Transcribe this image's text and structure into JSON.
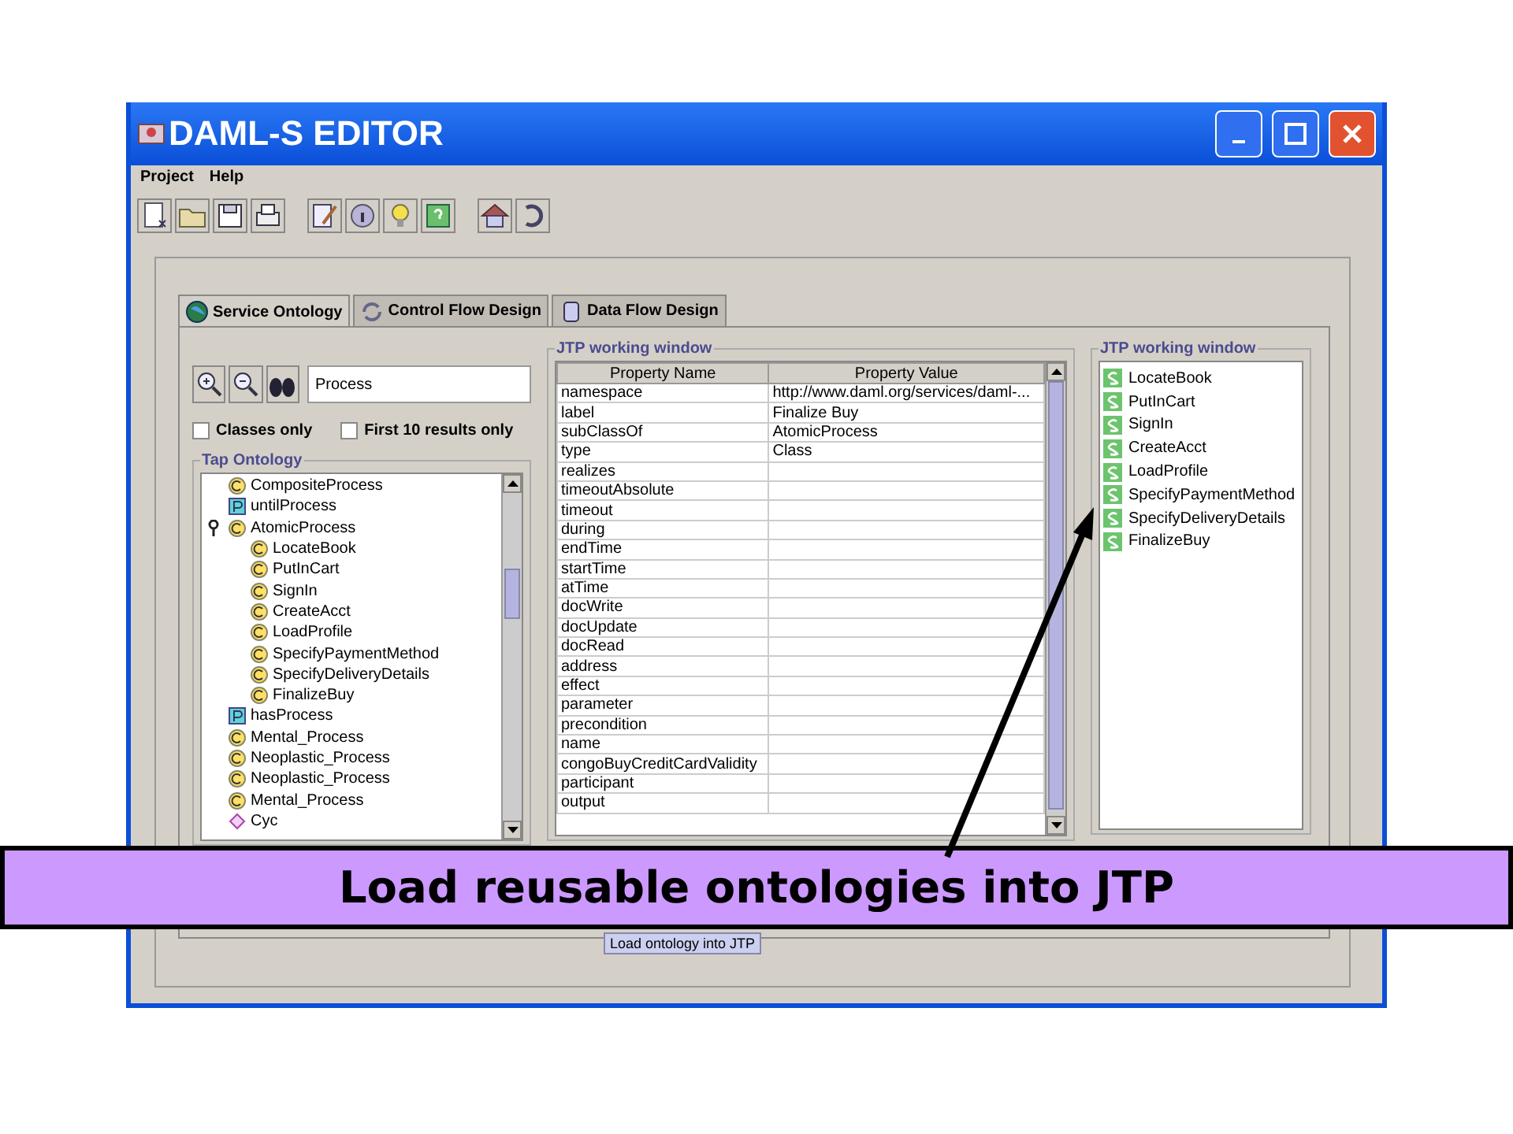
{
  "window": {
    "title": "DAML-S EDITOR"
  },
  "menu": [
    "Project",
    "Help"
  ],
  "tabs": [
    {
      "label": "Service Ontology",
      "selected": true
    },
    {
      "label": "Control Flow Design",
      "selected": false
    },
    {
      "label": "Data Flow Design",
      "selected": false
    }
  ],
  "search": {
    "value": "Process"
  },
  "options": [
    {
      "label": "Classes only",
      "checked": false
    },
    {
      "label": "First 10 results only",
      "checked": false
    }
  ],
  "tree": {
    "title": "Tap Ontology",
    "items": [
      {
        "label": "CompositeProcess",
        "kind": "class",
        "expanded": false
      },
      {
        "label": "untilProcess",
        "kind": "property",
        "expanded": false
      },
      {
        "label": "AtomicProcess",
        "kind": "class",
        "expanded": true,
        "children": [
          {
            "label": "LocateBook",
            "kind": "class"
          },
          {
            "label": "PutInCart",
            "kind": "class"
          },
          {
            "label": "SignIn",
            "kind": "class"
          },
          {
            "label": "CreateAcct",
            "kind": "class"
          },
          {
            "label": "LoadProfile",
            "kind": "class"
          },
          {
            "label": "SpecifyPaymentMethod",
            "kind": "class"
          },
          {
            "label": "SpecifyDeliveryDetails",
            "kind": "class"
          },
          {
            "label": "FinalizeBuy",
            "kind": "class"
          }
        ]
      },
      {
        "label": "hasProcess",
        "kind": "property",
        "expanded": false
      },
      {
        "label": "Mental_Process",
        "kind": "class",
        "expanded": false
      },
      {
        "label": "Neoplastic_Process",
        "kind": "class",
        "expanded": false
      },
      {
        "label": "Neoplastic_Process",
        "kind": "class",
        "expanded": false
      },
      {
        "label": "Mental_Process",
        "kind": "class",
        "expanded": false
      },
      {
        "label": "Cyc",
        "kind": "instance",
        "expanded": false
      }
    ]
  },
  "properties": {
    "title": "JTP working window",
    "columns": [
      "Property Name",
      "Property Value"
    ],
    "rows": [
      [
        "namespace",
        "http://www.daml.org/services/daml-..."
      ],
      [
        "label",
        "Finalize Buy"
      ],
      [
        "subClassOf",
        "AtomicProcess"
      ],
      [
        "type",
        "Class"
      ],
      [
        "realizes",
        ""
      ],
      [
        "timeoutAbsolute",
        ""
      ],
      [
        "timeout",
        ""
      ],
      [
        "during",
        ""
      ],
      [
        "endTime",
        ""
      ],
      [
        "startTime",
        ""
      ],
      [
        "atTime",
        ""
      ],
      [
        "docWrite",
        ""
      ],
      [
        "docUpdate",
        ""
      ],
      [
        "docRead",
        ""
      ],
      [
        "address",
        ""
      ],
      [
        "effect",
        ""
      ],
      [
        "parameter",
        ""
      ],
      [
        "precondition",
        ""
      ],
      [
        "name",
        ""
      ],
      [
        "congoBuyCreditCardValidity",
        ""
      ],
      [
        "participant",
        ""
      ],
      [
        "output",
        ""
      ]
    ]
  },
  "services": {
    "title": "JTP working window",
    "items": [
      "LocateBook",
      "PutInCart",
      "SignIn",
      "CreateAcct",
      "LoadProfile",
      "SpecifyPaymentMethod",
      "SpecifyDeliveryDetails",
      "FinalizeBuy"
    ]
  },
  "tooltip": "Load ontology into JTP",
  "caption": "Load reusable ontologies into JTP"
}
